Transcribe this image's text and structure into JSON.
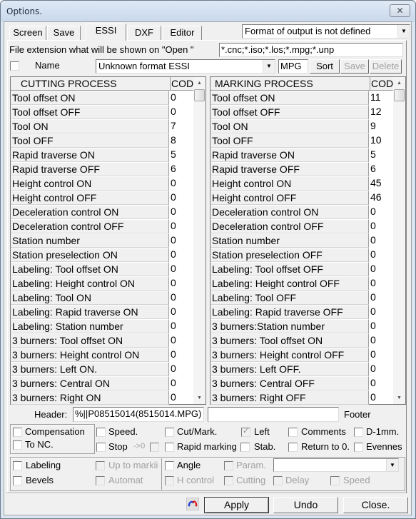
{
  "window": {
    "title": "Options.",
    "close_glyph": "✕"
  },
  "tabs": [
    {
      "label": "Screen",
      "active": false
    },
    {
      "label": "Save",
      "active": false
    },
    {
      "label": "ESSI",
      "active": true
    },
    {
      "label": "DXF",
      "active": false
    },
    {
      "label": "Editor",
      "active": false
    }
  ],
  "output_format": {
    "selected": "Format of output is not defined"
  },
  "file_extension": {
    "label": "File extension what will be shown on \"Open \"",
    "value": "*.cnc;*.iso;*.los;*.mpg;*.unp"
  },
  "name_row": {
    "label": "Name",
    "checked": false,
    "format_selected": "Unknown format ESSI",
    "extension_value": "MPG",
    "sort_label": "Sort",
    "save_label": "Save",
    "delete_label": "Delete"
  },
  "cutting": {
    "header": "CUTTING PROCESS",
    "code_header": "COD",
    "rows": [
      {
        "name": "Tool offset ON",
        "code": "0"
      },
      {
        "name": "Tool offset OFF",
        "code": "0"
      },
      {
        "name": "Tool ON",
        "code": "7"
      },
      {
        "name": "Tool OFF",
        "code": "8"
      },
      {
        "name": "Rapid traverse ON",
        "code": "5"
      },
      {
        "name": "Rapid traverse OFF",
        "code": "6"
      },
      {
        "name": "Height control ON",
        "code": "0"
      },
      {
        "name": "Height control OFF",
        "code": "0"
      },
      {
        "name": "Deceleration control ON",
        "code": "0"
      },
      {
        "name": "Deceleration control OFF",
        "code": "0"
      },
      {
        "name": "Station number",
        "code": "0"
      },
      {
        "name": "Station preselection ON",
        "code": "0"
      },
      {
        "name": "Labeling: Tool offset ON",
        "code": "0"
      },
      {
        "name": "Labeling: Height control ON",
        "code": "0"
      },
      {
        "name": "Labeling: Tool ON",
        "code": "0"
      },
      {
        "name": "Labeling: Rapid traverse ON",
        "code": "0"
      },
      {
        "name": "Labeling: Station number",
        "code": "0"
      },
      {
        "name": "3 burners: Tool offset ON",
        "code": "0"
      },
      {
        "name": "3 burners: Height control ON",
        "code": "0"
      },
      {
        "name": "3 burners: Left ON.",
        "code": "0"
      },
      {
        "name": "3 burners: Central ON",
        "code": "0"
      },
      {
        "name": "3 burners: Right ON",
        "code": "0"
      }
    ]
  },
  "marking": {
    "header": "MARKING PROCESS",
    "code_header": "COD",
    "rows": [
      {
        "name": "Tool offset ON",
        "code": "11"
      },
      {
        "name": "Tool offset OFF",
        "code": "12"
      },
      {
        "name": "Tool ON",
        "code": "9"
      },
      {
        "name": "Tool OFF",
        "code": "10"
      },
      {
        "name": "Rapid traverse ON",
        "code": "5"
      },
      {
        "name": "Rapid traverse OFF",
        "code": "6"
      },
      {
        "name": "Height control ON",
        "code": "45"
      },
      {
        "name": "Height control OFF",
        "code": "46"
      },
      {
        "name": "Deceleration control ON",
        "code": "0"
      },
      {
        "name": "Deceleration control OFF",
        "code": "0"
      },
      {
        "name": "Station number",
        "code": "0"
      },
      {
        "name": "Station preselection OFF",
        "code": "0"
      },
      {
        "name": "Labeling: Tool offset OFF",
        "code": "0"
      },
      {
        "name": "Labeling: Height control OFF",
        "code": "0"
      },
      {
        "name": "Labeling: Tool OFF",
        "code": "0"
      },
      {
        "name": "Labeling: Rapid traverse OFF",
        "code": "0"
      },
      {
        "name": "3 burners:Station number",
        "code": "0"
      },
      {
        "name": "3 burners: Tool offset ON",
        "code": "0"
      },
      {
        "name": "3 burners: Height control OFF",
        "code": "0"
      },
      {
        "name": "3 burners: Left OFF.",
        "code": "0"
      },
      {
        "name": "3 burners: Central OFF",
        "code": "0"
      },
      {
        "name": "3 burners: Right OFF",
        "code": "0"
      }
    ]
  },
  "header_field": {
    "label": "Header:",
    "value": "%||P08515014(8515014.MPG)"
  },
  "footer_field": {
    "label": "Footer",
    "value": ""
  },
  "options": {
    "compensation": {
      "label": "Compensation",
      "checked": false,
      "disabled": false
    },
    "to_nc": {
      "label": "To NC.",
      "checked": false,
      "disabled": false
    },
    "speed": {
      "label": "Speed.",
      "checked": false,
      "disabled": false
    },
    "stop": {
      "label": "Stop",
      "checked": false,
      "disabled": false
    },
    "stop_zero": {
      "label": "->0",
      "checked": false,
      "disabled": true
    },
    "cut_mark": {
      "label": "Cut/Mark.",
      "checked": false,
      "disabled": false
    },
    "rapid_marking": {
      "label": "Rapid marking",
      "checked": false,
      "disabled": false
    },
    "left": {
      "label": "Left",
      "checked": true,
      "disabled": true
    },
    "stab": {
      "label": "Stab.",
      "checked": false,
      "disabled": false
    },
    "comments": {
      "label": "Comments",
      "checked": false,
      "disabled": false
    },
    "return_to_0": {
      "label": "Return to 0.",
      "checked": false,
      "disabled": false
    },
    "d_1mm": {
      "label": "D-1mm.",
      "checked": false,
      "disabled": false
    },
    "evennes": {
      "label": "Evennes",
      "checked": false,
      "disabled": false
    },
    "labeling": {
      "label": "Labeling",
      "checked": false,
      "disabled": false
    },
    "bevels": {
      "label": "Bevels",
      "checked": false,
      "disabled": false
    },
    "up_to_marking": {
      "label": "Up to markii",
      "checked": false,
      "disabled": true
    },
    "automat": {
      "label": "Automat",
      "checked": false,
      "disabled": true
    },
    "angle": {
      "label": "Angle",
      "checked": false,
      "disabled": false
    },
    "h_control": {
      "label": "H control",
      "checked": false,
      "disabled": true
    },
    "param": {
      "label": "Param.",
      "checked": false,
      "disabled": true
    },
    "cutting": {
      "label": "Cutting",
      "checked": false,
      "disabled": true
    },
    "delay": {
      "label": "Delay",
      "checked": false,
      "disabled": true
    },
    "speed2": {
      "label": "Speed",
      "checked": false,
      "disabled": true
    }
  },
  "param_select": {
    "selected": ""
  },
  "footer_buttons": {
    "apply": "Apply",
    "undo": "Undo",
    "close": "Close."
  },
  "icons": {
    "refresh": "refresh-arrows-icon"
  }
}
